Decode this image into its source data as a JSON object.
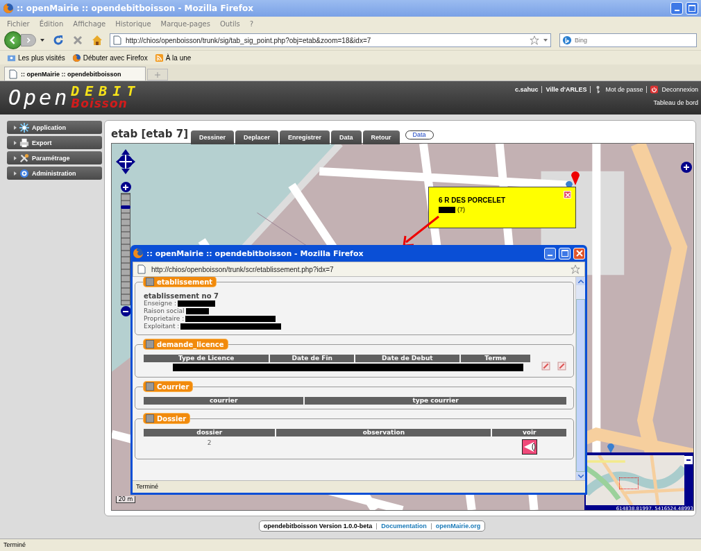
{
  "browser": {
    "title": ":: openMairie :: opendebitboisson - Mozilla Firefox",
    "menu": [
      "Fichier",
      "Édition",
      "Affichage",
      "Historique",
      "Marque-pages",
      "Outils",
      "?"
    ],
    "url": "http://chios/openboisson/trunk/sig/tab_sig_point.php?obj=etab&zoom=18&idx=7",
    "search": {
      "placeholder": "Bing"
    },
    "bookmarks": [
      {
        "label": "Les plus visités",
        "kind": "folder"
      },
      {
        "label": "Débuter avec Firefox",
        "kind": "firefox"
      },
      {
        "label": "À la une",
        "kind": "feed"
      }
    ],
    "tabs": [
      {
        "label": ":: openMairie :: opendebitboisson",
        "selected": true
      }
    ],
    "status": "Terminé"
  },
  "header": {
    "logo": {
      "open": "Open",
      "debit": "DEBIT",
      "boisson": "Boisson"
    },
    "user": "c.sahuc",
    "city": "Ville d'ARLES",
    "links": [
      {
        "label": "Mot de passe",
        "kind": "key"
      },
      {
        "label": "Deconnexion",
        "kind": "power"
      }
    ],
    "dashboard": "Tableau de bord"
  },
  "sidebar": {
    "items": [
      {
        "label": "Application",
        "kind": "application"
      },
      {
        "label": "Export",
        "kind": "export"
      },
      {
        "label": "Paramétrage",
        "kind": "settings"
      },
      {
        "label": "Administration",
        "kind": "admin"
      }
    ]
  },
  "page": {
    "title": "etab [etab 7]",
    "actions": [
      "Dessiner",
      "Deplacer",
      "Enregistrer",
      "Data",
      "Retour"
    ],
    "data_link": "Data"
  },
  "map": {
    "zoom": {
      "level": 0.94
    },
    "popup": {
      "address": "6 R DES PORCELET",
      "count": "(7)"
    },
    "scale": "20 m",
    "coordinates": "614838.81997, 5416524.48993"
  },
  "popup_window": {
    "title": ":: openMairie :: opendebitboisson - Mozilla Firefox",
    "url": "http://chios/openboisson/trunk/scr/etablissement.php?idx=7",
    "status": "Terminé",
    "sections": [
      {
        "title": "etablissement",
        "kind": "details",
        "heading": "etablissement no 7",
        "fields": [
          "Enseigne :",
          "Raison social",
          "Proprietaire :",
          "Exploitant :"
        ]
      },
      {
        "title": "demande_licence",
        "kind": "redacted_table",
        "columns": [
          "Type de Licence",
          "Date de Fin",
          "Date de Debut",
          "Terme"
        ]
      },
      {
        "title": "Courrier",
        "kind": "table",
        "columns": [
          "courrier",
          "type courrier"
        ]
      },
      {
        "title": "Dossier",
        "kind": "table",
        "columns": [
          "dossier",
          "observation",
          "voir"
        ],
        "rows": [
          [
            "2"
          ]
        ]
      }
    ]
  },
  "footer": {
    "version": "opendebitboisson Version 1.0.0-beta",
    "links": [
      "Documentation",
      "openMairie.org"
    ]
  }
}
